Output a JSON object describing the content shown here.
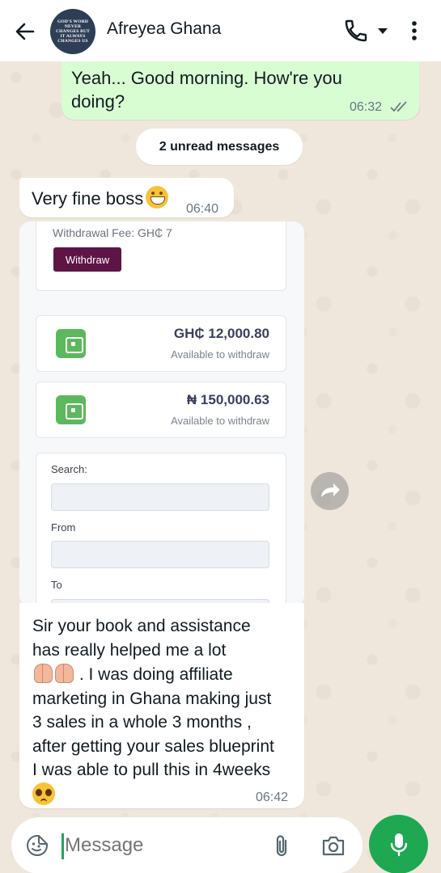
{
  "header": {
    "contact_name": "Afreyea Ghana",
    "avatar_text": "GOD'S WORD NEVER CHANGES BUT IT ALWAYS CHANGES US"
  },
  "messages": [
    {
      "direction": "outgoing",
      "text": "Yeah... Good morning. How're you doing?",
      "time": "06:32",
      "status": "read"
    },
    {
      "direction": "incoming",
      "text": "Very fine boss",
      "time": "06:40"
    },
    {
      "direction": "incoming",
      "text_lines": [
        "Sir your book and assistance",
        "has really helped me a lot",
        ". I was doing affiliate",
        "marketing in Ghana making just",
        "3 sales in a whole 3 months ,",
        "after getting your sales blueprint",
        "I was able to pull this in 4weeks"
      ],
      "time": "06:42"
    }
  ],
  "unread_pill": "2 unread messages",
  "screenshot": {
    "fee_label": "Withdrawal Fee: GH₵ 7",
    "withdraw_button": "Withdraw",
    "balances": [
      {
        "amount": "GH₵ 12,000.80",
        "sub": "Available to withdraw"
      },
      {
        "amount": "₦ 150,000.63",
        "sub": "Available to withdraw"
      }
    ],
    "search_label": "Search:",
    "from_label": "From",
    "to_label": "To"
  },
  "input": {
    "placeholder": "Message"
  },
  "icons": {
    "back": "arrow-left-icon",
    "call": "phone-icon",
    "dropdown": "caret-down-icon",
    "more": "more-vert-icon",
    "emoji": "sticker-icon",
    "attach": "paperclip-icon",
    "camera": "camera-icon",
    "mic": "microphone-icon",
    "share": "forward-icon"
  },
  "colors": {
    "accent": "#1da851",
    "outgoing_bubble": "#d9fdd3",
    "read_ticks": "#53bdeb"
  }
}
